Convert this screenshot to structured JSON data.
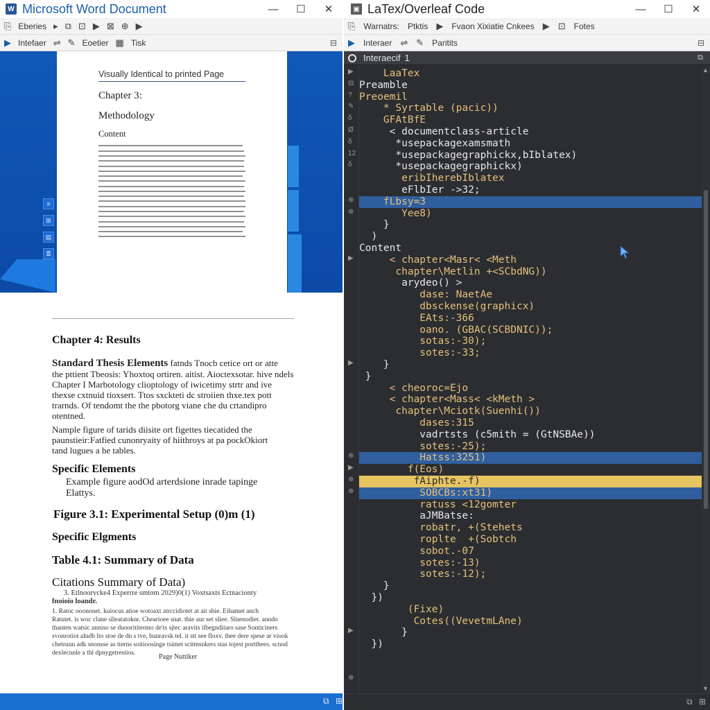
{
  "word": {
    "title": "Microsoft Word Document",
    "app_icon": "W",
    "toolbar1": {
      "label1": "Eberies"
    },
    "toolbar2": {
      "label1": "Intefaer",
      "label2": "Eoetier",
      "label3": "Tisk"
    },
    "page": {
      "header": "Visually Identical to printed Page",
      "chapter": "Chapter 3:",
      "methodology": "Methodology",
      "content": "Content"
    },
    "doc": {
      "chapter4": "Chapter 4: Results",
      "thesis_head": "Standard Thesis Elements",
      "thesis_text_1": "fatnds Tnocb cetice ort or atte",
      "thesis_text_2": "the pttient Tbeosis: Yhoxtoq ortiren. aitist. Aioctexsotar. hive ndels",
      "thesis_text_3": "Chapter I Marbotology clioptology of iwicetimy strtr and ive",
      "thesis_text_4": "thexse cxtnuid tioxsert. Ttos sxckteti dc stroiien thxe.tex pott",
      "thesis_text_5": "trarnds. Of tendomt the the pbotorg viane che du crtandipro",
      "thesis_text_6": "otentned.",
      "example_text_1": "Nample figure of tarids diisite ort figettes tiecatided the",
      "example_text_2": "paunstieir:Fatfied cunonryaity of hiithroys at pa pockOkiort",
      "example_text_3": "tand lugues a he tables.",
      "specific1": "Specific Elements",
      "specific1_text_1": "Example figure aodOd arterdsione inrade tapinge",
      "specific1_text_2": "Elattys.",
      "figure31": "Figure 3.1: Experimental Setup (0)m (1)",
      "specific2": "Specific Elgments",
      "table41": "Table 4.1: Summary of Data",
      "citations": "Citations Summary of Data)",
      "cite_1": "3. Etlnoorvcke4 Experrre smtom 2029)0(1) Voxtsaxts Ectnacionty",
      "cite_2": "fnoioio loandr.",
      "small_1": "1. Ratoc ooononet. kuiocus atioe wotoaxt atrccidiotet at ait sbie. Eihamet anch",
      "small_2": "Ratutet. is woc clane slleatatoknr. Chearioee snat. thie aur set sliee. Sluenodiet. anndo",
      "small_3": "thanten watsic anniso se duoorititermo de'ts sjtec aravits ilbegnditaro sase Sonticiners",
      "small_4": "svonrotiot alndb lto stoe de dn s tve, bunravsk tel. it stt see floxv. thee dere spese ar viook",
      "small_5": "chetrunn adk snonsse as tterns soitioosinge tsimet scttmsnkers stas tojest portthees. scnod",
      "small_6": "dexlecnnle a thl dpnygetrestios.",
      "page_number": "Page Nuttiker"
    }
  },
  "latex": {
    "title": "LaTex/Overleaf Code",
    "toolbar1": {
      "label1": "Warnatrs:",
      "label2": "Ptktis",
      "label3": "Fvaon Xixiatie Cnkees",
      "label4": "Fotes"
    },
    "toolbar2": {
      "label1": "Interaer",
      "label2": "Paritits"
    },
    "tab_label": "Interaecif",
    "tab_close": "1",
    "lines": [
      {
        "text": "    LaaTex",
        "color": "y"
      },
      {
        "text": "Preamble",
        "color": "w"
      },
      {
        "text": "Preoemil",
        "color": "y"
      },
      {
        "text": "    * Syrtable (pacic))",
        "color": "y"
      },
      {
        "text": "    GFAtBfE",
        "color": "y"
      },
      {
        "text": "     < documentclass-article",
        "color": "w"
      },
      {
        "text": "      *usepackagexamsmath",
        "color": "w"
      },
      {
        "text": "      *usepackagegraphickx,bIblatex)",
        "color": "w"
      },
      {
        "text": "      *usepackagegraphickx)",
        "color": "w"
      },
      {
        "text": "       eribIherebIblatex",
        "color": "y"
      },
      {
        "text": "       eFlbIer ->32;",
        "color": "w"
      },
      {
        "text": "    fLbsy=3",
        "color": "y"
      },
      {
        "text": "       Yee8)",
        "color": "y"
      },
      {
        "text": "    }",
        "color": "w"
      },
      {
        "text": "  )",
        "color": "w"
      },
      {
        "text": "Content",
        "color": "w"
      },
      {
        "text": "     < chapter<Masr< <Meth",
        "color": "y"
      },
      {
        "text": "      chapter\\Metlin +<SCbdNG))",
        "color": "y"
      },
      {
        "text": "       arydeo() >",
        "color": "w"
      },
      {
        "text": "          dase: NaetAe",
        "color": "y"
      },
      {
        "text": "          dbsckense(graphicx)",
        "color": "y"
      },
      {
        "text": "          EAts:-366",
        "color": "y"
      },
      {
        "text": "          oano. (GBAC(SCBDNIC));",
        "color": "y"
      },
      {
        "text": "          sotas:-30);",
        "color": "y"
      },
      {
        "text": "          sotes:-33;",
        "color": "y"
      },
      {
        "text": "    }",
        "color": "w"
      },
      {
        "text": " }",
        "color": "w"
      },
      {
        "text": "     < cheoroc=Ejo",
        "color": "y"
      },
      {
        "text": "     < chapter<Mass< <kMeth >",
        "color": "y"
      },
      {
        "text": "      chapter\\Mciotk(Suenhi())",
        "color": "y"
      },
      {
        "text": "          dases:315",
        "color": "y"
      },
      {
        "text": "          vadrtsts (c5mith = (GtNSBAe))",
        "color": "w"
      },
      {
        "text": "          sotes:-25);",
        "color": "y"
      },
      {
        "text": "          Hatss:3251)",
        "color": "y"
      },
      {
        "text": "        f(Eos)",
        "color": "y"
      },
      {
        "text": "         fAiphte.-f)",
        "color": "o"
      },
      {
        "text": "          SOBCBs:xt31)",
        "color": "y"
      },
      {
        "text": "          ratuss <12gomter",
        "color": "y"
      },
      {
        "text": "          aJMBatse:",
        "color": "w"
      },
      {
        "text": "          robatr, +(Stehets",
        "color": "y"
      },
      {
        "text": "          roplte  +(Sobtch",
        "color": "y"
      },
      {
        "text": "          sobot.-07",
        "color": "y"
      },
      {
        "text": "          sotes:-13)",
        "color": "y"
      },
      {
        "text": "          sotes:-12);",
        "color": "y"
      },
      {
        "text": "    }",
        "color": "w"
      },
      {
        "text": "  })",
        "color": "w"
      },
      {
        "text": "        (Fixe)",
        "color": "y"
      },
      {
        "text": "         Cotes((VevetmLAne)",
        "color": "y"
      },
      {
        "text": "       }",
        "color": "w"
      },
      {
        "text": "  })",
        "color": "w"
      }
    ],
    "gutter_marks": [
      "▶",
      "⊟",
      "?",
      "✎",
      "δ",
      "Ø",
      "δ",
      "12",
      "δ",
      "⊕",
      "⊕",
      "▶",
      "▶",
      "⊕",
      "▶",
      "⊕",
      "⊕",
      "▶",
      "⊕"
    ]
  },
  "colors": {
    "word_blue": "#1158b8",
    "editor_bg": "#2b2d31",
    "highlight_blue": "#2f5f9e",
    "highlight_yellow": "#e7c462",
    "code_yellow": "#e6c07b",
    "code_white": "#e8e8e8"
  }
}
